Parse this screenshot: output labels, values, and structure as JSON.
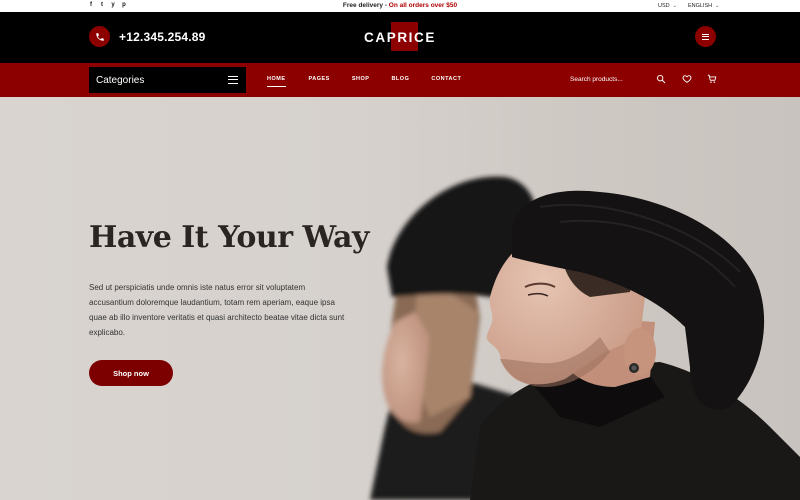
{
  "topbar": {
    "social": [
      "f",
      "t",
      "y",
      "p"
    ],
    "promo_lead": "Free delivery - ",
    "promo_highlight": "On all orders over $50",
    "currency": "USD",
    "language": "ENGLISH"
  },
  "header": {
    "phone": "+12.345.254.89",
    "logo": "CAPRICE"
  },
  "nav": {
    "categories_label": "Categories",
    "links": [
      "HOME",
      "PAGES",
      "SHOP",
      "BLOG",
      "CONTACT"
    ],
    "search_placeholder": "Search products..."
  },
  "hero": {
    "title": "Have It Your Way",
    "body": "Sed ut perspiciatis unde omnis iste natus error sit voluptatem accusantium doloremque laudantium, totam rem aperiam, eaque ipsa quae ab illo inventore veritatis et quasi architecto beatae vitae dicta sunt explicabo.",
    "button": "Shop now"
  },
  "colors": {
    "brand_red": "#8c0000",
    "header_black": "#000000",
    "hero_bg": "#d6d1cd"
  },
  "icons": [
    "facebook-icon",
    "twitter-icon",
    "youtube-icon",
    "pinterest-icon",
    "phone-icon",
    "menu-icon",
    "burger-icon",
    "search-icon",
    "heart-icon",
    "cart-icon",
    "chevron-down-icon"
  ]
}
